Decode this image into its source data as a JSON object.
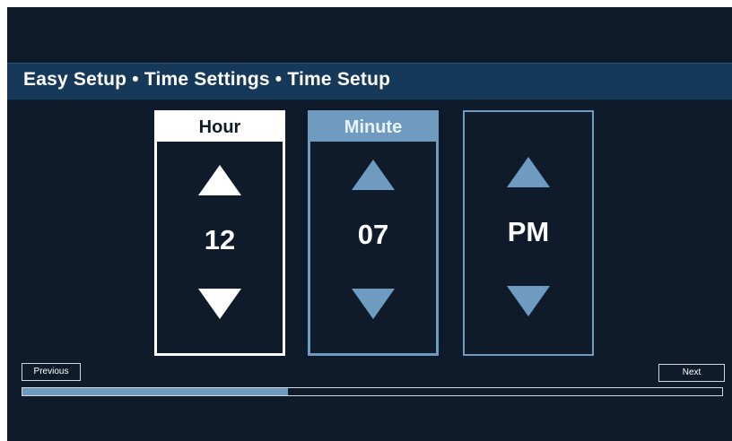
{
  "breadcrumb": "Easy Setup • Time Settings • Time Setup",
  "time_picker": {
    "hour": {
      "label": "Hour",
      "value": "12"
    },
    "minute": {
      "label": "Minute",
      "value": "07"
    },
    "period": {
      "value": "PM"
    }
  },
  "navigation": {
    "previous_label": "Previous",
    "next_label": "Next"
  },
  "progress": {
    "fraction": 0.38
  },
  "colors": {
    "background": "#0f1b2a",
    "title_bar": "#16395a",
    "accent": "#6f9bc0",
    "focus": "#ffffff"
  },
  "icons": {
    "increment": "triangle-up-icon",
    "decrement": "triangle-down-icon"
  }
}
